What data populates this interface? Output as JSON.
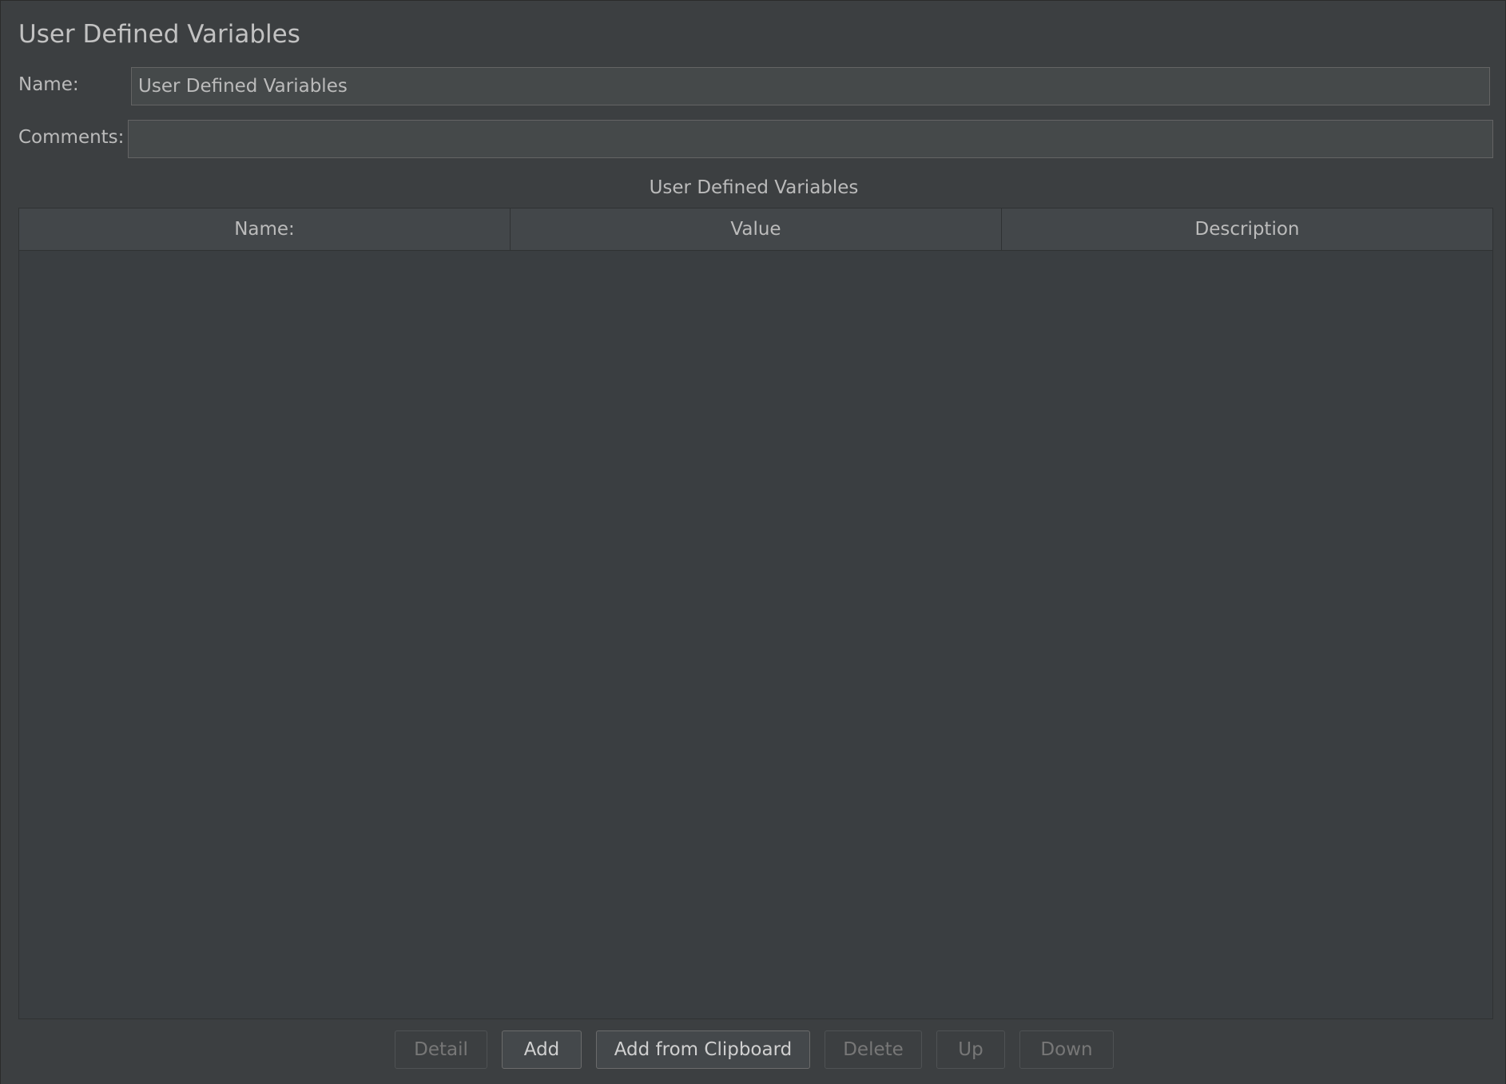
{
  "panel": {
    "title": "User Defined Variables"
  },
  "form": {
    "name_label": "Name:",
    "name_value": "User Defined Variables",
    "comments_label": "Comments:",
    "comments_value": ""
  },
  "table": {
    "title": "User Defined Variables",
    "columns": [
      "Name:",
      "Value",
      "Description"
    ],
    "rows": []
  },
  "buttons": {
    "detail": "Detail",
    "add": "Add",
    "add_from_clipboard": "Add from Clipboard",
    "delete": "Delete",
    "up": "Up",
    "down": "Down"
  }
}
